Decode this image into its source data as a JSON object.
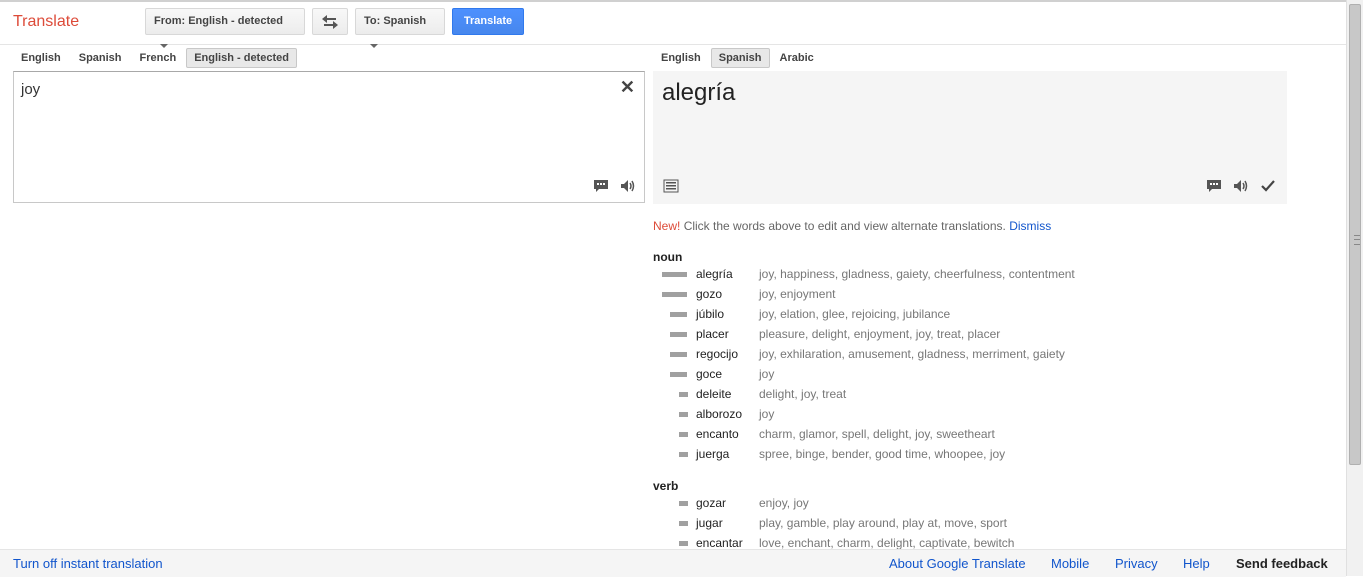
{
  "app": {
    "title": "Translate"
  },
  "toolbar": {
    "from_label": "From: English - detected",
    "to_label": "To: Spanish",
    "translate_label": "Translate",
    "swap_icon": "swap-icon"
  },
  "source": {
    "languages": [
      {
        "label": "English",
        "selected": false
      },
      {
        "label": "Spanish",
        "selected": false
      },
      {
        "label": "French",
        "selected": false
      },
      {
        "label": "English - detected",
        "selected": true
      }
    ],
    "text": "joy"
  },
  "target": {
    "languages": [
      {
        "label": "English",
        "selected": false
      },
      {
        "label": "Spanish",
        "selected": true
      },
      {
        "label": "Arabic",
        "selected": false
      }
    ],
    "text": "alegría"
  },
  "notice": {
    "new": "New!",
    "message": "Click the words above to edit and view alternate translations.",
    "dismiss": "Dismiss"
  },
  "dictionary": [
    {
      "pos": "noun",
      "entries": [
        {
          "term": "alegría",
          "reverse": "joy, happiness, gladness, gaiety, cheerfulness, contentment",
          "freq": 3
        },
        {
          "term": "gozo",
          "reverse": "joy, enjoyment",
          "freq": 3
        },
        {
          "term": "júbilo",
          "reverse": "joy, elation, glee, rejoicing, jubilance",
          "freq": 2
        },
        {
          "term": "placer",
          "reverse": "pleasure, delight, enjoyment, joy, treat, placer",
          "freq": 2
        },
        {
          "term": "regocijo",
          "reverse": "joy, exhilaration, amusement, gladness, merriment, gaiety",
          "freq": 2
        },
        {
          "term": "goce",
          "reverse": "joy",
          "freq": 2
        },
        {
          "term": "deleite",
          "reverse": "delight, joy, treat",
          "freq": 1
        },
        {
          "term": "alborozo",
          "reverse": "joy",
          "freq": 1
        },
        {
          "term": "encanto",
          "reverse": "charm, glamor, spell, delight, joy, sweetheart",
          "freq": 1
        },
        {
          "term": "juerga",
          "reverse": "spree, binge, bender, good time, whoopee, joy",
          "freq": 1
        }
      ]
    },
    {
      "pos": "verb",
      "entries": [
        {
          "term": "gozar",
          "reverse": "enjoy, joy",
          "freq": 1
        },
        {
          "term": "jugar",
          "reverse": "play, gamble, play around, play at, move, sport",
          "freq": 1
        },
        {
          "term": "encantar",
          "reverse": "love, enchant, charm, delight, captivate, bewitch",
          "freq": 1
        }
      ]
    }
  ],
  "footer": {
    "turn_off": "Turn off instant translation",
    "about": "About Google Translate",
    "mobile": "Mobile",
    "privacy": "Privacy",
    "help": "Help",
    "feedback": "Send feedback"
  }
}
